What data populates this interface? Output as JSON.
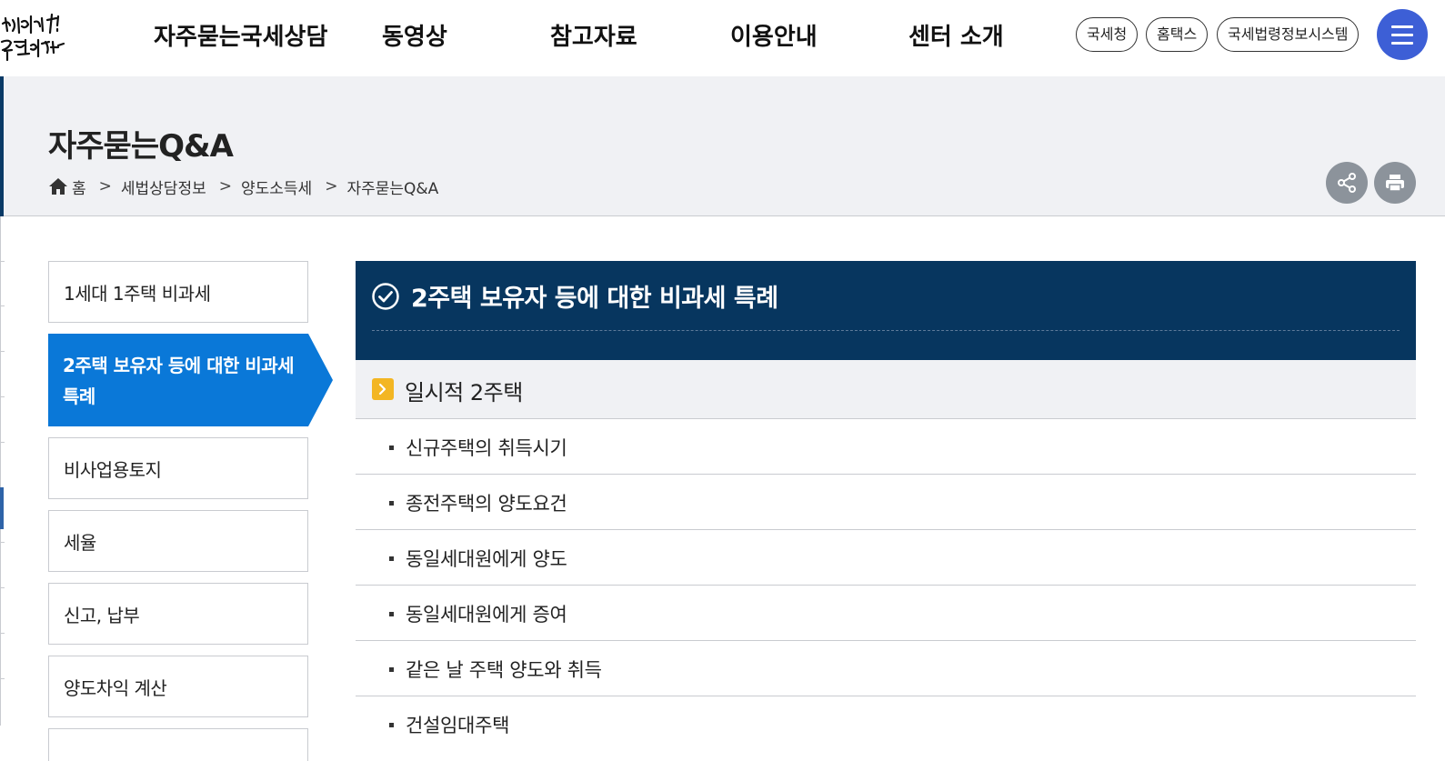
{
  "header": {
    "logo_text": "대한민국! 국민이 나라",
    "nav": [
      "자주묻는국세상담",
      "동영상",
      "참고자료",
      "이용안내",
      "센터 소개"
    ],
    "links": [
      "국세청",
      "홈택스",
      "국세법령정보시스템"
    ],
    "menu_icon": "hamburger-icon",
    "accent_color": "#3d5fd6"
  },
  "page": {
    "title": "자주묻는Q&A",
    "breadcrumb": [
      "홈",
      "세법상담정보",
      "양도소득세",
      "자주묻는Q&A"
    ],
    "share_icon": "share-icon",
    "print_icon": "print-icon"
  },
  "sidebar": {
    "items": [
      {
        "label": "1세대 1주택 비과세",
        "active": false
      },
      {
        "label": "2주택 보유자 등에 대한 비과세 특례",
        "active": true
      },
      {
        "label": "비사업용토지",
        "active": false
      },
      {
        "label": "세율",
        "active": false
      },
      {
        "label": "신고, 납부",
        "active": false
      },
      {
        "label": "양도차익 계산",
        "active": false
      }
    ],
    "active_color": "#0a78d8"
  },
  "content": {
    "title": "2주택 보유자 등에 대한 비과세 특례",
    "header_color": "#07365f",
    "section": {
      "title": "일시적 2주택",
      "items": [
        "신규주택의 취득시기",
        "종전주택의 양도요건",
        "동일세대원에게 양도",
        "동일세대원에게 증여",
        "같은 날 주택 양도와 취득",
        "건설임대주택"
      ]
    }
  }
}
